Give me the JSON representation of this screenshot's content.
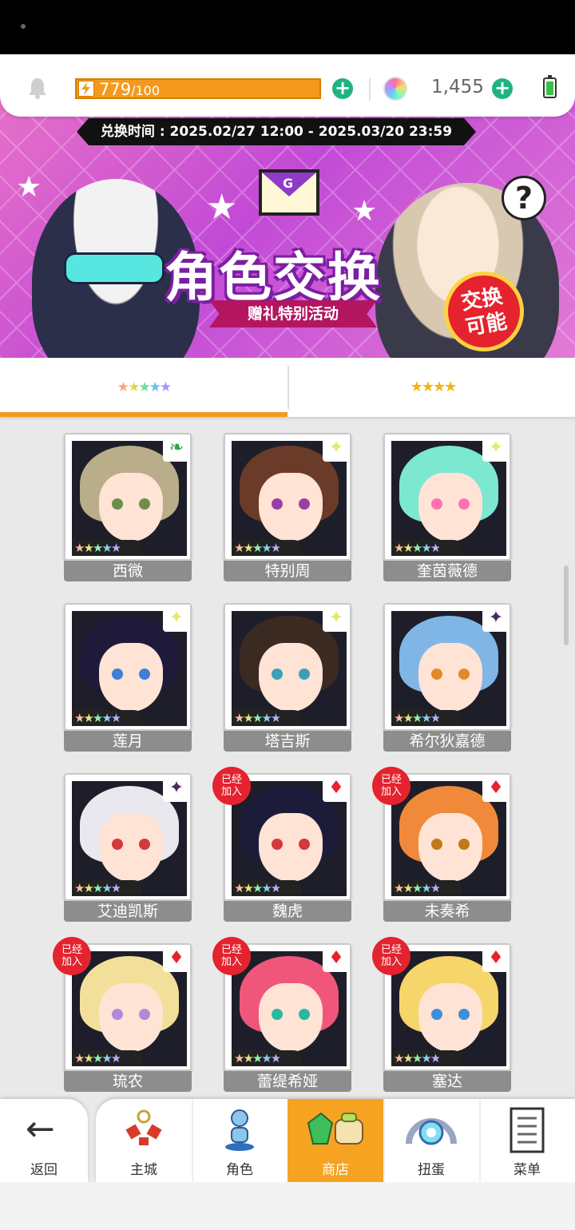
{
  "topbar": {
    "stamina_value": "779",
    "stamina_max": "/100",
    "gems": "1,455"
  },
  "banner": {
    "period": "兑换时间 : 2025.02/27 12:00 - 2025.03/20 23:59",
    "title": "角色交换",
    "subtitle": "赠礼特别活动",
    "badge_line1": "交换",
    "badge_line2": "可能",
    "envelope_letter": "G",
    "help": "?"
  },
  "tabs": [
    {
      "stars": "★★★★★"
    },
    {
      "stars": "★★★★"
    }
  ],
  "cards": [
    {
      "name": "西微",
      "stars": "★★★★★",
      "attr": "leaf",
      "joined": false,
      "hair": "#b9ad8a",
      "eye": "#6b8f4a"
    },
    {
      "name": "特别周",
      "stars": "★★★★★",
      "attr": "sparkle",
      "joined": false,
      "hair": "#6b3b2a",
      "eye": "#9b3ea6"
    },
    {
      "name": "奎茵薇德",
      "stars": "★★★★★",
      "attr": "sparkle",
      "joined": false,
      "hair": "#7de8d0",
      "eye": "#ff6fb4"
    },
    {
      "name": "莲月",
      "stars": "★★★★★",
      "attr": "sparkle",
      "joined": false,
      "hair": "#1f1a3a",
      "eye": "#3f7fd8"
    },
    {
      "name": "塔吉斯",
      "stars": "★★★★★",
      "attr": "sparkle",
      "joined": false,
      "hair": "#3b2a22",
      "eye": "#3aa0b8"
    },
    {
      "name": "希尔狄嘉德",
      "stars": "★★★★★",
      "attr": "dark",
      "joined": false,
      "hair": "#7fb6e6",
      "eye": "#e08a2a"
    },
    {
      "name": "艾迪凯斯",
      "stars": "★★★★★",
      "attr": "dark",
      "joined": false,
      "hair": "#e8e8ee",
      "eye": "#d23a3a"
    },
    {
      "name": "魏虎",
      "stars": "★★★★★",
      "attr": "fire",
      "joined": true,
      "joined_label": "已经加入",
      "hair": "#1c1c3a",
      "eye": "#d23a3a"
    },
    {
      "name": "未奏希",
      "stars": "★★★★★",
      "attr": "fire",
      "joined": true,
      "joined_label": "已经加入",
      "hair": "#f08a3a",
      "eye": "#c07a1a"
    },
    {
      "name": "琉农",
      "stars": "★★★★★",
      "attr": "fire",
      "joined": true,
      "joined_label": "已经加入",
      "hair": "#f2e09a",
      "eye": "#b08ad8"
    },
    {
      "name": "蕾缇希娅",
      "stars": "★★★★★",
      "attr": "fire",
      "joined": true,
      "joined_label": "已经加入",
      "hair": "#f0567a",
      "eye": "#2ab8a0"
    },
    {
      "name": "塞达",
      "stars": "★★★★★",
      "attr": "fire",
      "joined": true,
      "joined_label": "已经加入",
      "hair": "#f6d56a",
      "eye": "#3f8fd8"
    }
  ],
  "nav": {
    "back_label": "返回",
    "items": [
      {
        "label": "主城",
        "icon": "castle-icon",
        "active": false
      },
      {
        "label": "角色",
        "icon": "character-icon",
        "active": false
      },
      {
        "label": "商店",
        "icon": "shop-icon",
        "active": true
      },
      {
        "label": "扭蛋",
        "icon": "gacha-icon",
        "active": false
      },
      {
        "label": "菜单",
        "icon": "menu-icon",
        "active": false
      }
    ]
  },
  "colors": {
    "accent": "#f39a1e",
    "plus_green": "#1fb383",
    "joined_red": "#e4232f",
    "name_bar": "#8d8d8d"
  }
}
